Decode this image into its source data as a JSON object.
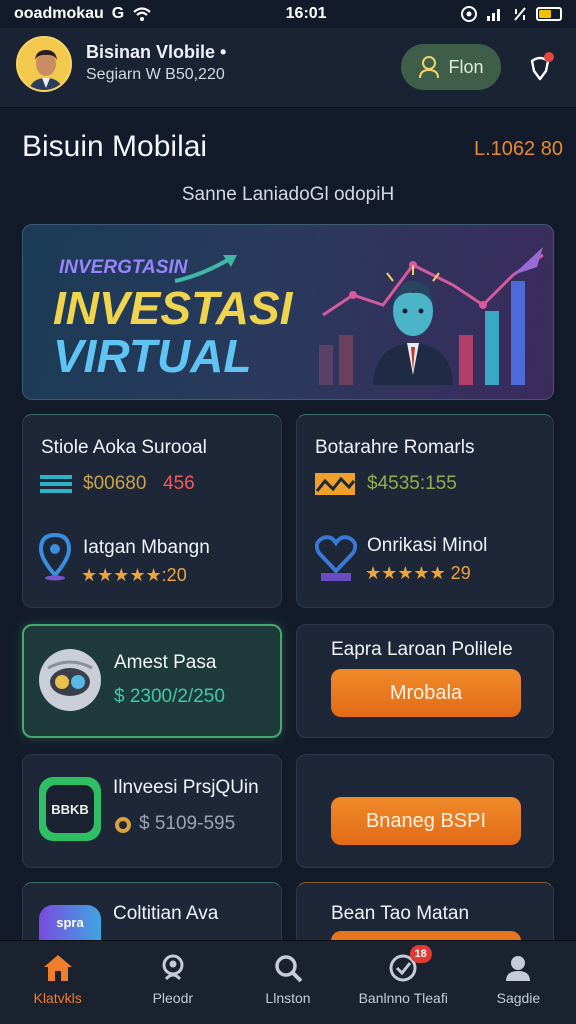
{
  "status_bar": {
    "carrier": "ooadmokau",
    "carrier_g": "G",
    "time": "16:01"
  },
  "header": {
    "user_name": "Bisinan Vlobile •",
    "user_sub": "Segiarn W B50,220",
    "profile_button": "Flon"
  },
  "page": {
    "title": "Bisuin Mobilai",
    "value": "L.1062 80",
    "tagline": "Sanne LaniadoGl odopiH"
  },
  "banner": {
    "small_title": "INVERGTASIN",
    "title_line1": "INVESTASI",
    "title_line2": "VIRTUAL"
  },
  "cards": [
    {
      "title": "Stiole Aoka Surooal",
      "price": "$00680",
      "price_change": "456",
      "sub_title": "Iatgan Mbangn",
      "rating": "★★★★★:20"
    },
    {
      "title": "Botarahre Romarls",
      "price": "$4535:155",
      "sub_title": "Onrikasi Minol",
      "rating": "★★★★★ 29"
    },
    {
      "title": "Amest Pasa",
      "price": "$ 2300/2/250"
    },
    {
      "title": "Eapra Laroan Polilele",
      "button": "Mrobala"
    },
    {
      "title": "Ilnveesi PrsjQUin",
      "icon_text": "BBKB",
      "price": "$ 5109-595"
    },
    {
      "title": "",
      "button": "Bnaneg BSPI"
    },
    {
      "title": "Coltitian Ava",
      "icon_text": "spra"
    },
    {
      "title": "Bean Tao Matan"
    }
  ],
  "tabs": [
    {
      "label": "Klatvkls",
      "icon": "home-icon"
    },
    {
      "label": "Pleodr",
      "icon": "user-search-icon"
    },
    {
      "label": "Llnston",
      "icon": "search-icon"
    },
    {
      "label": "Banlnno Tleafi",
      "icon": "check-circle-icon",
      "badge": "18"
    },
    {
      "label": "Sagdie",
      "icon": "profile-icon"
    }
  ],
  "colors": {
    "background": "#131b2a",
    "accent_orange": "#ef7d29",
    "accent_green": "#46a86a",
    "price_green": "#8fdc5e",
    "price_red": "#ef5a5a"
  }
}
